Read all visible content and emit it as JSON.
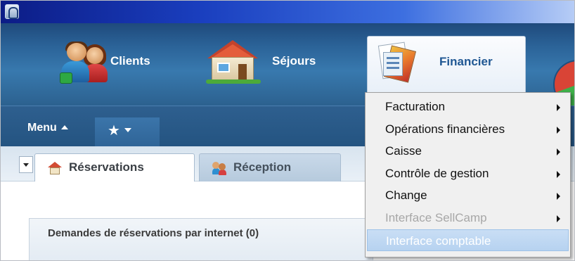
{
  "modules": [
    {
      "label": "Clients",
      "icon": "clients-icon"
    },
    {
      "label": "Séjours",
      "icon": "house-icon"
    },
    {
      "label": "Financier",
      "icon": "finance-icon",
      "active": true
    }
  ],
  "menubar": {
    "menu_label": "Menu",
    "favorites_icon": "star-icon"
  },
  "tabs": [
    {
      "label": "Réservations",
      "icon": "house-icon",
      "active": true
    },
    {
      "label": "Réception",
      "icon": "people-icon",
      "active": false
    }
  ],
  "panel": {
    "title": "Demandes de réservations par internet (0)"
  },
  "dropdown": {
    "items": [
      {
        "label": "Facturation",
        "submenu": true,
        "enabled": true
      },
      {
        "label": "Opérations financières",
        "submenu": true,
        "enabled": true
      },
      {
        "label": "Caisse",
        "submenu": true,
        "enabled": true
      },
      {
        "label": "Contrôle de gestion",
        "submenu": true,
        "enabled": true
      },
      {
        "label": "Change",
        "submenu": true,
        "enabled": true
      },
      {
        "label": "Interface SellCamp",
        "submenu": true,
        "enabled": false
      },
      {
        "label": "Interface comptable",
        "submenu": false,
        "enabled": true,
        "highlighted": true
      }
    ]
  },
  "colors": {
    "title_bar": "#1a3fbf",
    "accent": "#1f5793",
    "highlight": "#b6d2f0"
  }
}
